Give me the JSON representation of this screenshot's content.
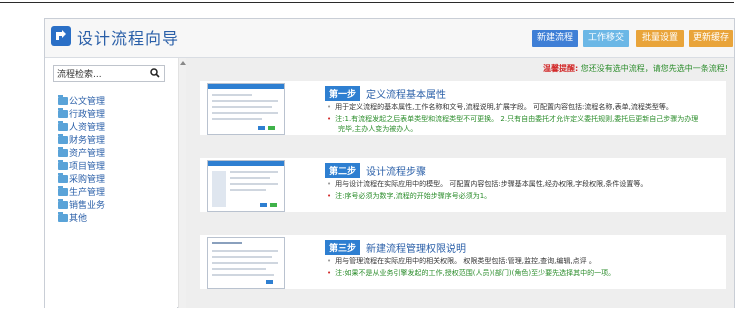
{
  "header": {
    "title": "设计流程向导",
    "buttons": [
      "新建流程",
      "工作移交",
      "批量设置",
      "更新缓存"
    ]
  },
  "sidebar": {
    "search_placeholder": "流程检索...",
    "items": [
      "公文管理",
      "行政管理",
      "人资管理",
      "财务管理",
      "资产管理",
      "项目管理",
      "采购管理",
      "生产管理",
      "销售业务",
      "其他"
    ]
  },
  "notice": {
    "label": "温馨提醒:",
    "text": "您还没有选中流程，请您先选中一条流程!"
  },
  "steps": [
    {
      "badge": "第一步",
      "title": "定义流程基本属性",
      "desc": "用于定义流程的基本属性,工作名称和文号,流程说明,扩展字段。 可配置内容包括:流程名称,表单,流程类型等。",
      "note_a": "注:1.有流程发起之后表单类型和流程类型不可更换。 2.只有自由委托才允许定义委托规则,委托后更新自己步骤为办理",
      "note_b": "完毕,主办人变为被办人。"
    },
    {
      "badge": "第二步",
      "title": "设计流程步骤",
      "desc": "用与设计流程在实际应用中的模型。 可配置内容包括:步骤基本属性,经办权限,字段权限,条件设置等。",
      "note_a": "注:序号必须为数字,流程的开始步骤序号必须为1。"
    },
    {
      "badge": "第三步",
      "title": "新建流程管理权限说明",
      "desc": "用与管理流程在实际应用中的相关权限。 权限类型包括:管理,监控,查询,编辑,点评 。",
      "note_a": "注:如果不是从业务引擎发起的工作,授权范围(人员)(部门)(角色)至少要先选择其中的一项。"
    }
  ],
  "colors": {
    "accent": "#2a5fa8",
    "step_badge": "#2e7fd1",
    "orange_button": "#e9a43a",
    "note_green": "#2a8c2a",
    "warn_red": "#d22a2a"
  }
}
